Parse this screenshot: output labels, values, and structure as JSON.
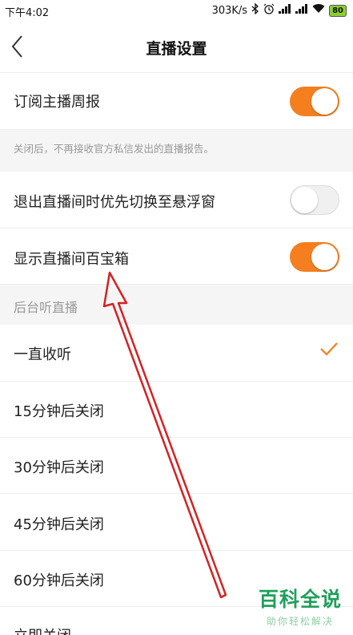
{
  "status_bar": {
    "time": "下午4:02",
    "network_speed": "303K/s",
    "battery": "80",
    "icons": [
      "bluetooth-icon",
      "alarm-icon",
      "signal-icon",
      "signal-icon",
      "wifi-icon",
      "battery-icon"
    ]
  },
  "header": {
    "title": "直播设置",
    "back_icon": "chevron-left-icon"
  },
  "settings": [
    {
      "label": "订阅主播周报",
      "toggle": "on"
    },
    {
      "label": "退出直播间时优先切换至悬浮窗",
      "toggle": "off"
    },
    {
      "label": "显示直播间百宝箱",
      "toggle": "on"
    }
  ],
  "subscription_hint": "关闭后，不再接收官方私信发出的直播报告。",
  "background_listening": {
    "section_title": "后台听直播",
    "options": [
      "一直收听",
      "15分钟后关闭",
      "30分钟后关闭",
      "45分钟后关闭",
      "60分钟后关闭",
      "立即关闭"
    ],
    "selected_index": 0,
    "check_icon": "checkmark-icon"
  },
  "watermark": {
    "title": "百科全说",
    "subtitle": "助你轻松解决"
  },
  "colors": {
    "accent": "#f57e1f",
    "watermark_green": "#1fa05a",
    "annotation_red": "#d42222"
  }
}
